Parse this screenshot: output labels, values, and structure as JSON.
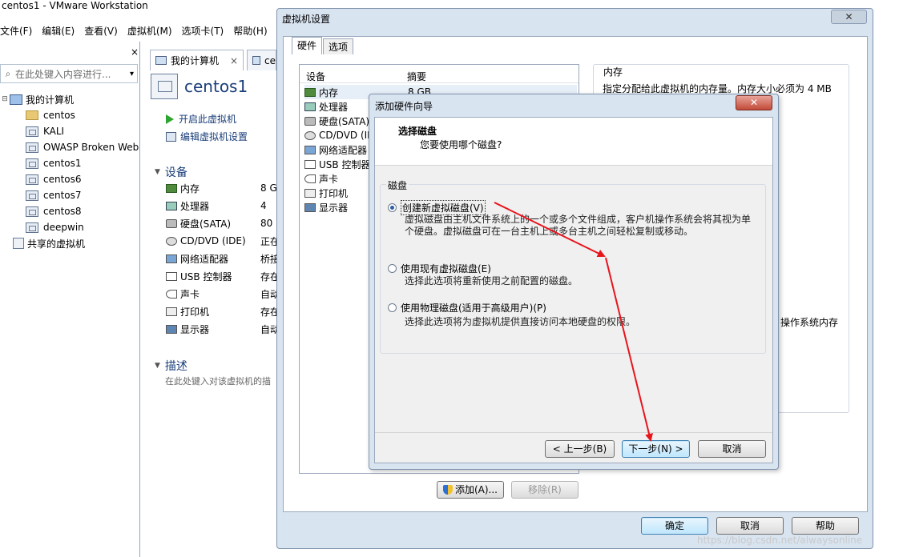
{
  "window_title": "centos1 - VMware Workstation",
  "menu": [
    "文件(F)",
    "编辑(E)",
    "查看(V)",
    "虚拟机(M)",
    "选项卡(T)",
    "帮助(H)"
  ],
  "library": {
    "close": "×",
    "search_placeholder": "在此处键入内容进行...",
    "dropdown": "▾",
    "root": "我的计算机",
    "items": [
      "centos",
      "KALI",
      "OWASP Broken Web",
      "centos1",
      "centos6",
      "centos7",
      "centos8",
      "deepwin"
    ],
    "shared": "共享的虚拟机"
  },
  "tabs": [
    {
      "label": "我的计算机",
      "close": "×"
    },
    {
      "label": "ce"
    }
  ],
  "vm": {
    "name": "centos1",
    "actions": [
      "开启此虚拟机",
      "编辑虚拟机设置"
    ],
    "devices_title": "设备",
    "devices": [
      {
        "name": "内存",
        "value": "8 G",
        "icon": "memory-icon"
      },
      {
        "name": "处理器",
        "value": "4",
        "icon": "cpu-icon"
      },
      {
        "name": "硬盘(SATA)",
        "value": "80",
        "icon": "disk-icon"
      },
      {
        "name": "CD/DVD (IDE)",
        "value": "正在",
        "icon": "cd-icon"
      },
      {
        "name": "网络适配器",
        "value": "桥接",
        "icon": "network-icon"
      },
      {
        "name": "USB 控制器",
        "value": "存在",
        "icon": "usb-icon"
      },
      {
        "name": "声卡",
        "value": "自动",
        "icon": "sound-icon"
      },
      {
        "name": "打印机",
        "value": "存在",
        "icon": "printer-icon"
      },
      {
        "name": "显示器",
        "value": "自动",
        "icon": "monitor-icon"
      }
    ],
    "desc_title": "描述",
    "desc_placeholder": "在此处键入对该虚拟机的描"
  },
  "settings_dialog": {
    "title": "虚拟机设置",
    "close": "✕",
    "tabs": [
      "硬件",
      "选项"
    ],
    "col_device": "设备",
    "col_summary": "摘要",
    "devices": [
      "内存",
      "处理器",
      "硬盘(SATA)",
      "CD/DVD (ID",
      "网络适配器",
      "USB 控制器",
      "声卡",
      "打印机",
      "显示器"
    ],
    "first_summary": "8 GB",
    "memory_title": "内存",
    "memory_desc": "指定分配给此虚拟机的内存量。内存大小必须为 4 MB",
    "memory_tail": "操作系统内存",
    "add_button": "添加(A)...",
    "remove_button": "移除(R)",
    "ok": "确定",
    "cancel": "取消",
    "help": "帮助"
  },
  "wizard": {
    "title": "添加硬件向导",
    "close": "✕",
    "heading": "选择磁盘",
    "subheading": "您要使用哪个磁盘?",
    "group_label": "磁盘",
    "options": [
      {
        "label": "创建新虚拟磁盘(V)",
        "desc1": "虚拟磁盘由主机文件系统上的一个或多个文件组成，客户机操作系统会将其视为单",
        "desc2": "个硬盘。虚拟磁盘可在一台主机上或多台主机之间轻松复制或移动。",
        "selected": true
      },
      {
        "label": "使用现有虚拟磁盘(E)",
        "desc1": "选择此选项将重新使用之前配置的磁盘。",
        "selected": false
      },
      {
        "label": "使用物理磁盘(适用于高级用户)(P)",
        "desc1": "选择此选项将为虚拟机提供直接访问本地硬盘的权限。",
        "selected": false
      }
    ],
    "back": "< 上一步(B)",
    "next": "下一步(N) >",
    "cancel": "取消"
  },
  "watermark": "https://blog.csdn.net/alwaysonline",
  "annotation_color": "#e8141c"
}
